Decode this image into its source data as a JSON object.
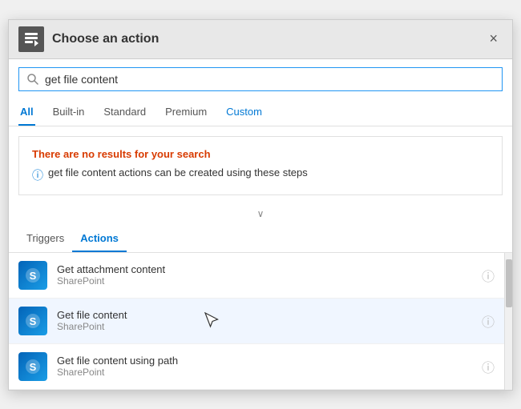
{
  "header": {
    "title": "Choose an action",
    "close_label": "×"
  },
  "search": {
    "placeholder": "",
    "value": "get file content",
    "icon": "🔍"
  },
  "tabs": [
    {
      "label": "All",
      "active": true
    },
    {
      "label": "Built-in",
      "active": false
    },
    {
      "label": "Standard",
      "active": false
    },
    {
      "label": "Premium",
      "active": false
    },
    {
      "label": "Custom",
      "active": false
    }
  ],
  "no_results": {
    "title": "There are no results for your search",
    "info": "get file content actions can be created using these steps"
  },
  "sub_tabs": [
    {
      "label": "Triggers",
      "active": false
    },
    {
      "label": "Actions",
      "active": true
    }
  ],
  "results": [
    {
      "name": "Get attachment content",
      "source": "SharePoint",
      "highlighted": false
    },
    {
      "name": "Get file content",
      "source": "SharePoint",
      "highlighted": true
    },
    {
      "name": "Get file content using path",
      "source": "SharePoint",
      "highlighted": false
    }
  ],
  "icons": {
    "info_circle": "ⓘ",
    "chevron_down": "∨",
    "circle_info": "ⓘ"
  }
}
